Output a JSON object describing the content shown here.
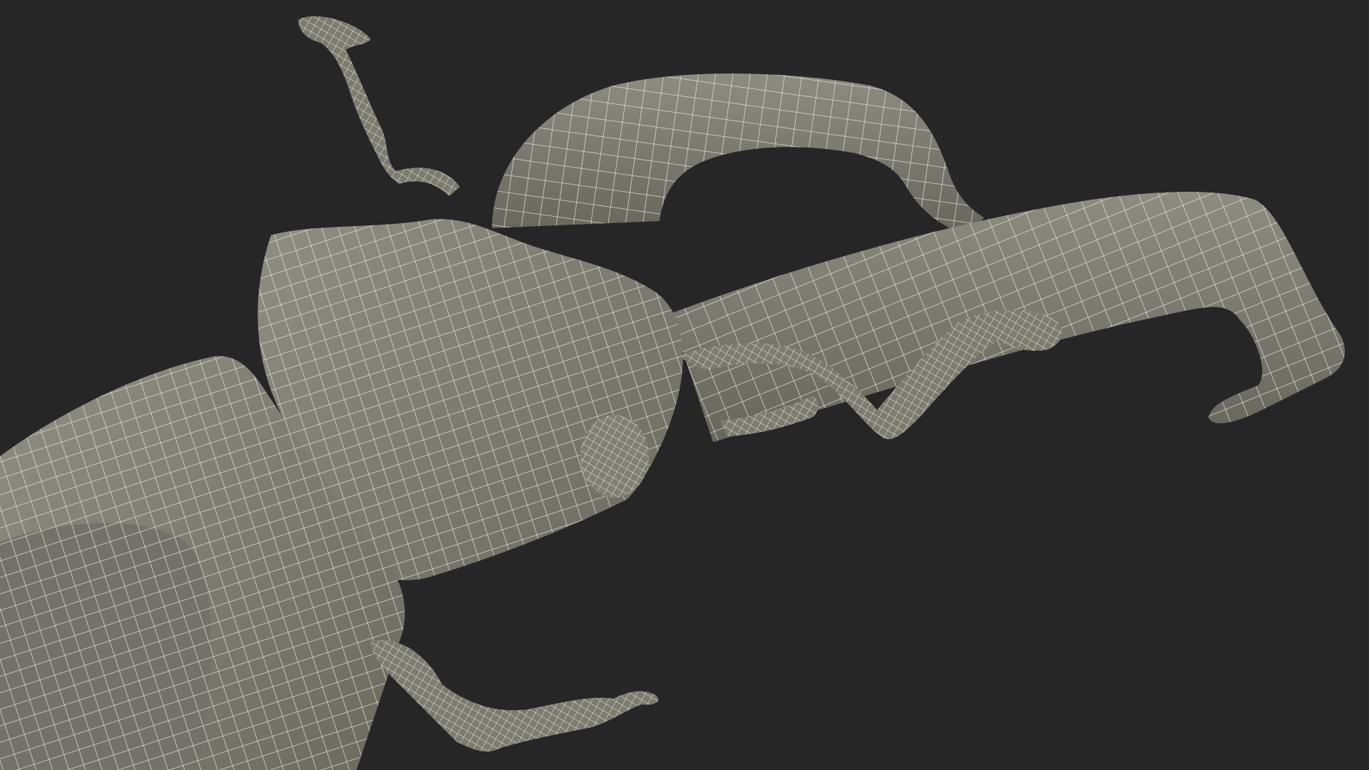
{
  "scene": {
    "subject": "stag-beetle-wireframe",
    "colors": {
      "background": "#262626",
      "surface": "#7b7b70",
      "surface_light": "#8e8e83",
      "surface_dark": "#5f5f56",
      "wire": "#ecebdf"
    }
  }
}
